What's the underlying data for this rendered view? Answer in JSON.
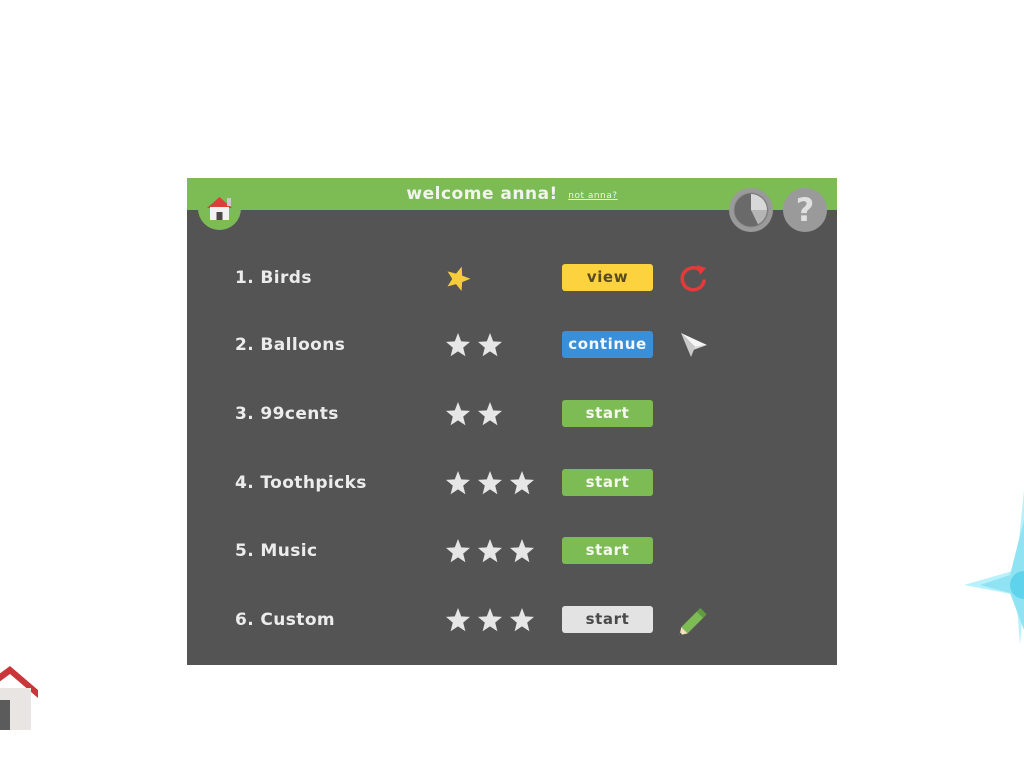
{
  "header": {
    "welcome": "welcome anna!",
    "not_user_link": "not anna?"
  },
  "icons": {
    "home": "home-icon",
    "stats": "pie-chart-icon",
    "help": "question-mark-icon"
  },
  "colors": {
    "header_green": "#7dbb55",
    "panel_gray": "#545454",
    "view": "#fdd23f",
    "continue": "#3a8fd9",
    "start": "#7dbb55",
    "start_disabled": "#e3e3e3",
    "star_earned": "#f5cd3a",
    "star_empty": "#e6e6e6",
    "refresh": "#e63a3a"
  },
  "lessons": [
    {
      "label": "1. Birds",
      "stars_total": 1,
      "stars_earned": 1,
      "button": "view",
      "button_style": "view",
      "icon": "refresh-icon"
    },
    {
      "label": "2. Balloons",
      "stars_total": 2,
      "stars_earned": 0,
      "button": "continue",
      "button_style": "continue",
      "icon": "paper-plane-icon"
    },
    {
      "label": "3. 99cents",
      "stars_total": 2,
      "stars_earned": 0,
      "button": "start",
      "button_style": "start",
      "icon": ""
    },
    {
      "label": "4. Toothpicks",
      "stars_total": 3,
      "stars_earned": 0,
      "button": "start",
      "button_style": "start",
      "icon": ""
    },
    {
      "label": "5. Music",
      "stars_total": 3,
      "stars_earned": 0,
      "button": "start",
      "button_style": "start",
      "icon": ""
    },
    {
      "label": "6. Custom",
      "stars_total": 3,
      "stars_earned": 0,
      "button": "start",
      "button_style": "start_disabled",
      "icon": "pencil-icon"
    }
  ]
}
